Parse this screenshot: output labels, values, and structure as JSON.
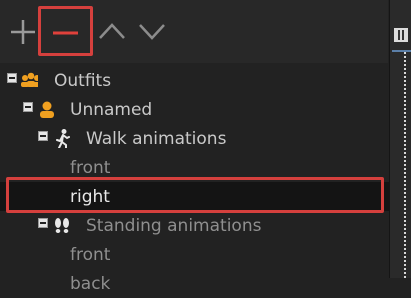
{
  "toolbar": {
    "buttons": [
      {
        "name": "add",
        "icon": "plus-icon"
      },
      {
        "name": "remove",
        "icon": "minus-icon",
        "highlighted": true
      },
      {
        "name": "move-up",
        "icon": "chevron-up-icon"
      },
      {
        "name": "move-down",
        "icon": "chevron-down-icon"
      }
    ]
  },
  "tree": {
    "root": {
      "label": "Outfits",
      "icon": "group-icon"
    },
    "character": {
      "label": "Unnamed",
      "icon": "person-icon"
    },
    "walk_group": {
      "label": "Walk animations",
      "icon": "walking-person-icon"
    },
    "walk_front": {
      "label": "front"
    },
    "walk_right": {
      "label": "right",
      "selected": true
    },
    "standing_group": {
      "label": "Standing animations",
      "icon": "footprints-icon"
    },
    "standing_front": {
      "label": "front"
    },
    "standing_back": {
      "label": "back"
    }
  },
  "colors": {
    "highlight_outline": "#d5403d",
    "icon_orange": "#f0a020",
    "text": "#c9c9c9",
    "background": "#222222"
  }
}
